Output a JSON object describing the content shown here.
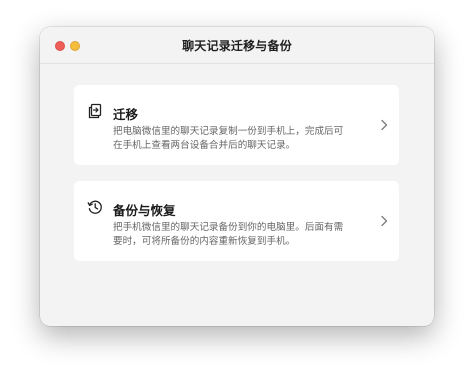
{
  "window": {
    "title": "聊天记录迁移与备份"
  },
  "options": {
    "migrate": {
      "title": "迁移",
      "description": "把电脑微信里的聊天记录复制一份到手机上，完成后可在手机上查看两台设备合并后的聊天记录。",
      "icon": "migrate-icon"
    },
    "backup": {
      "title": "备份与恢复",
      "description": "把手机微信里的聊天记录备份到你的电脑里。后面有需要时，可将所备份的内容重新恢复到手机。",
      "icon": "history-icon"
    }
  },
  "colors": {
    "close": "#ee5f57",
    "minimize": "#f5bd3c",
    "window_bg": "#f3f3f3",
    "card_bg": "#ffffff"
  }
}
